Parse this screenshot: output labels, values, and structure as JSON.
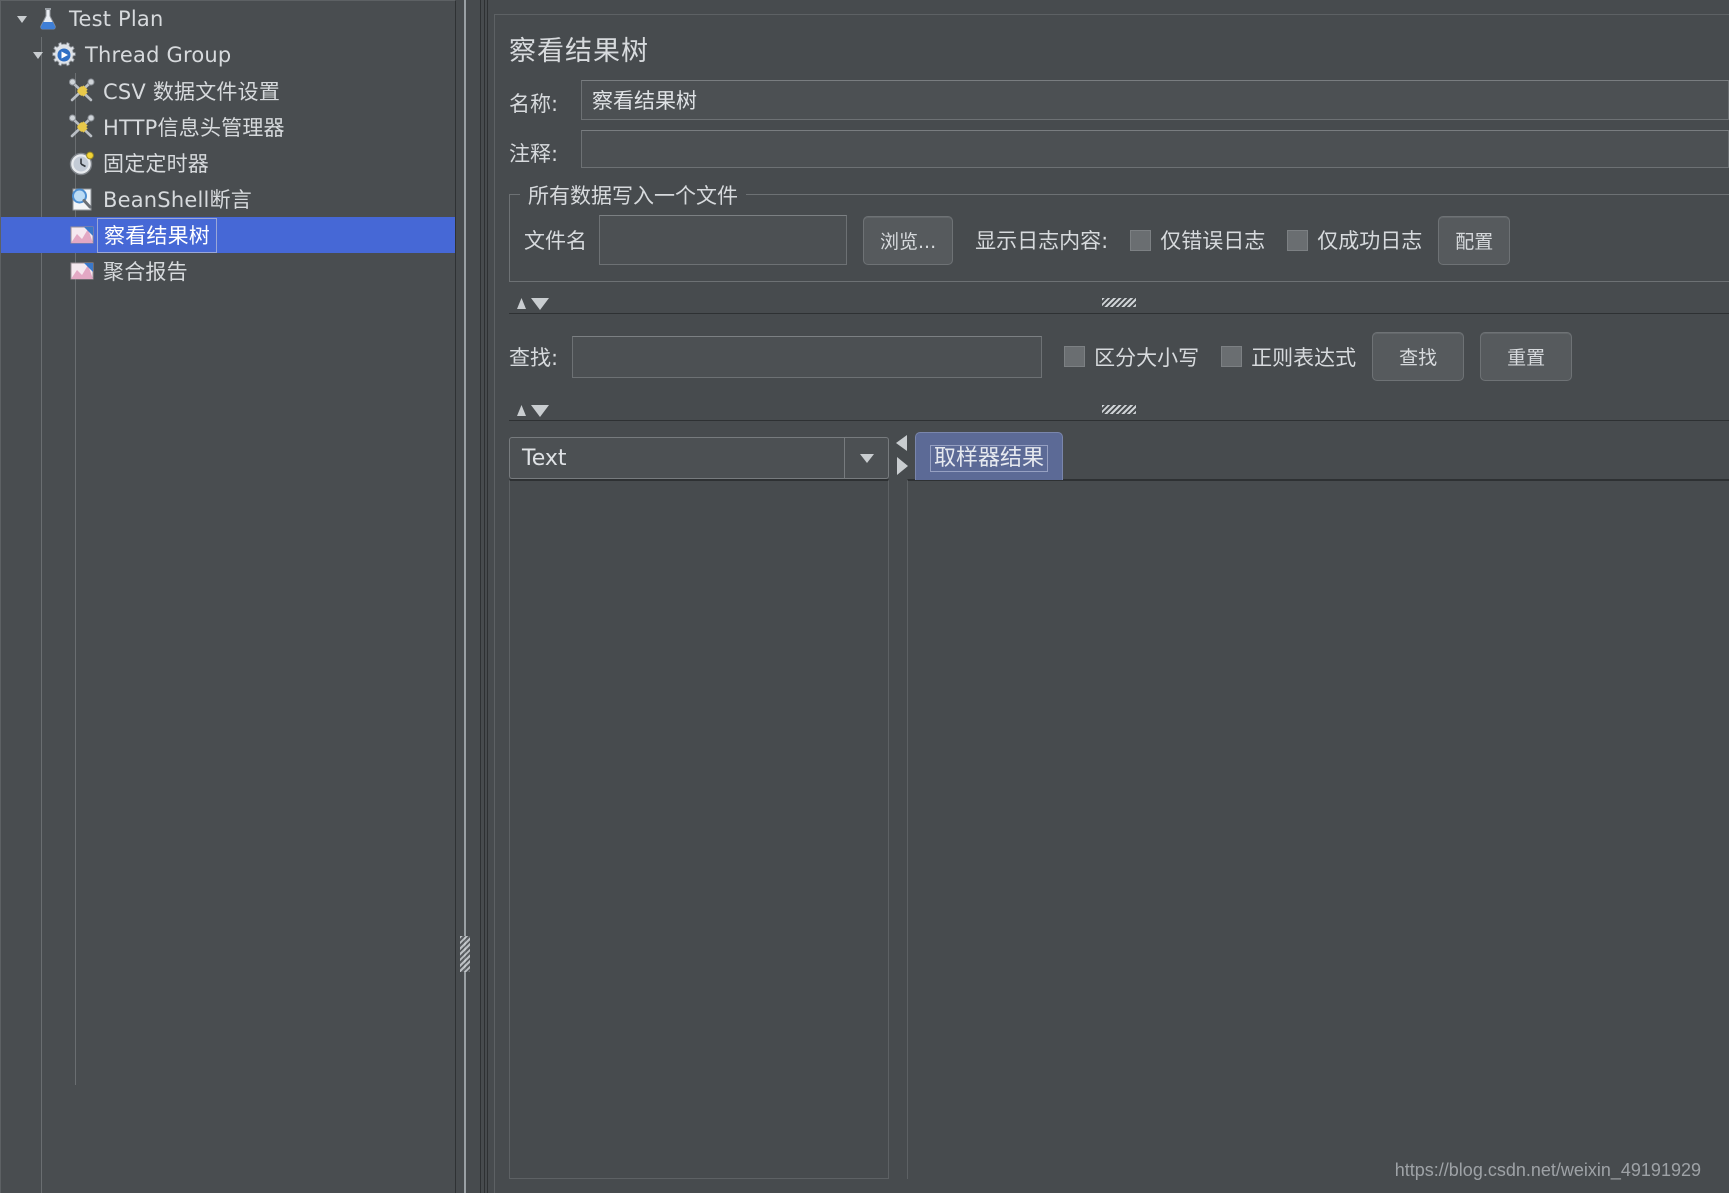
{
  "app": {
    "bg_color": "#474b4e",
    "accent_color": "#4668d6",
    "tab_color": "#5c6a96"
  },
  "tree": {
    "items": [
      {
        "label": "Test Plan",
        "icon": "flask-icon",
        "depth": 0,
        "twisty": "down",
        "selected": false
      },
      {
        "label": "Thread Group",
        "icon": "gear-icon",
        "depth": 1,
        "twisty": "down",
        "selected": false
      },
      {
        "label": "CSV 数据文件设置",
        "icon": "config-tools-icon",
        "depth": 2,
        "twisty": "none",
        "selected": false
      },
      {
        "label": "HTTP信息头管理器",
        "icon": "config-tools-icon",
        "depth": 2,
        "twisty": "none",
        "selected": false
      },
      {
        "label": "固定定时器",
        "icon": "timer-clock-icon",
        "depth": 2,
        "twisty": "none",
        "selected": false
      },
      {
        "label": "BeanShell断言",
        "icon": "assertion-magnifier-icon",
        "depth": 2,
        "twisty": "none",
        "selected": false
      },
      {
        "label": "察看结果树",
        "icon": "listener-chart-icon",
        "depth": 2,
        "twisty": "none",
        "selected": true
      },
      {
        "label": "聚合报告",
        "icon": "listener-chart-icon",
        "depth": 2,
        "twisty": "none",
        "selected": false
      }
    ]
  },
  "panel": {
    "title": "察看结果树",
    "name_label": "名称:",
    "name_value": "察看结果树",
    "comment_label": "注释:",
    "comment_value": ""
  },
  "file_group": {
    "legend": "所有数据写入一个文件",
    "filename_label": "文件名",
    "filename_value": "",
    "browse_button": "浏览...",
    "log_display_label": "显示日志内容:",
    "checkbox_errors_only": {
      "label": "仅错误日志",
      "checked": false
    },
    "checkbox_success_only": {
      "label": "仅成功日志",
      "checked": false
    },
    "configure_button": "配置"
  },
  "search": {
    "label": "查找:",
    "value": "",
    "checkbox_case_sensitive": {
      "label": "区分大小写",
      "checked": false
    },
    "checkbox_regex": {
      "label": "正则表达式",
      "checked": false
    },
    "find_button": "查找",
    "reset_button": "重置"
  },
  "results": {
    "renderer_selected": "Text",
    "tab_label": "取样器结果",
    "left_pane_content": "",
    "right_pane_content": ""
  },
  "watermark": "https://blog.csdn.net/weixin_49191929"
}
